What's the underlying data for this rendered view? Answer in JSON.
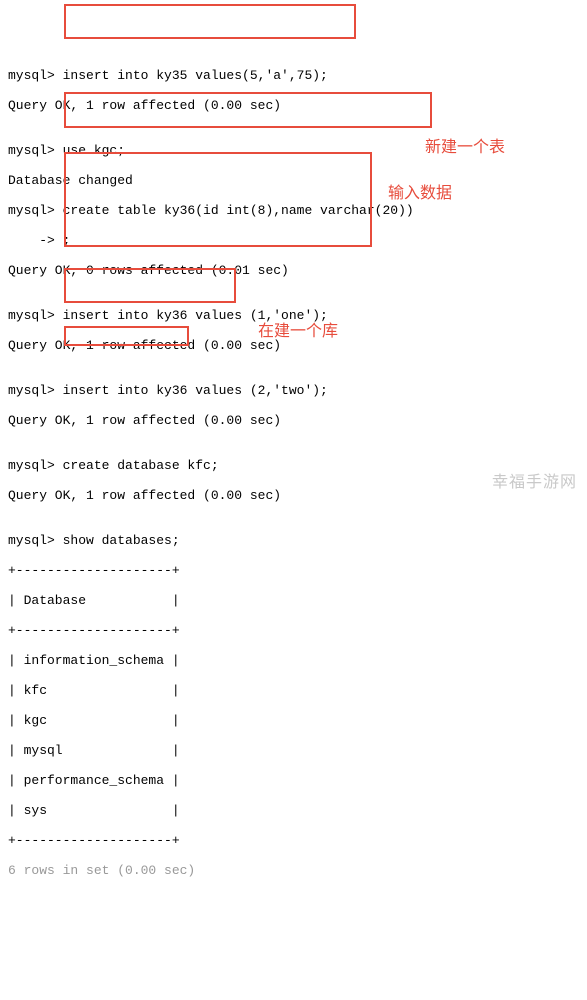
{
  "lines": {
    "l01": "mysql> insert into ky35 values(5,'a',75);",
    "l02": "Query OK, 1 row affected (0.00 sec)",
    "l03": "",
    "l04": "mysql> use kgc;",
    "l05": "Database changed",
    "l06": "mysql> create table ky36(id int(8),name varchar(20))",
    "l07": "    -> ;",
    "l08": "Query OK, 0 rows affected (0.01 sec)",
    "l09": "",
    "l10": "mysql> insert into ky36 values (1,'one');",
    "l11": "Query OK, 1 row affected (0.00 sec)",
    "l12": "",
    "l13": "mysql> insert into ky36 values (2,'two');",
    "l14": "Query OK, 1 row affected (0.00 sec)",
    "l15": "",
    "l16": "mysql> create database kfc;",
    "l17": "Query OK, 1 row affected (0.00 sec)",
    "l18": "",
    "l19": "mysql> show databases;",
    "l20": "+--------------------+",
    "l21": "| Database           |",
    "l22": "+--------------------+",
    "l23": "| information_schema |",
    "l24": "| kfc                |",
    "l25": "| kgc                |",
    "l26": "| mysql              |",
    "l27": "| performance_schema |",
    "l28": "| sys                |",
    "l29": "+--------------------+",
    "l30": "6 rows in set (0.00 sec)"
  },
  "labels": {
    "label1": "新建一个表",
    "label2": "输入数据",
    "label3": "在建一个库"
  },
  "watermark": "幸福手游网"
}
